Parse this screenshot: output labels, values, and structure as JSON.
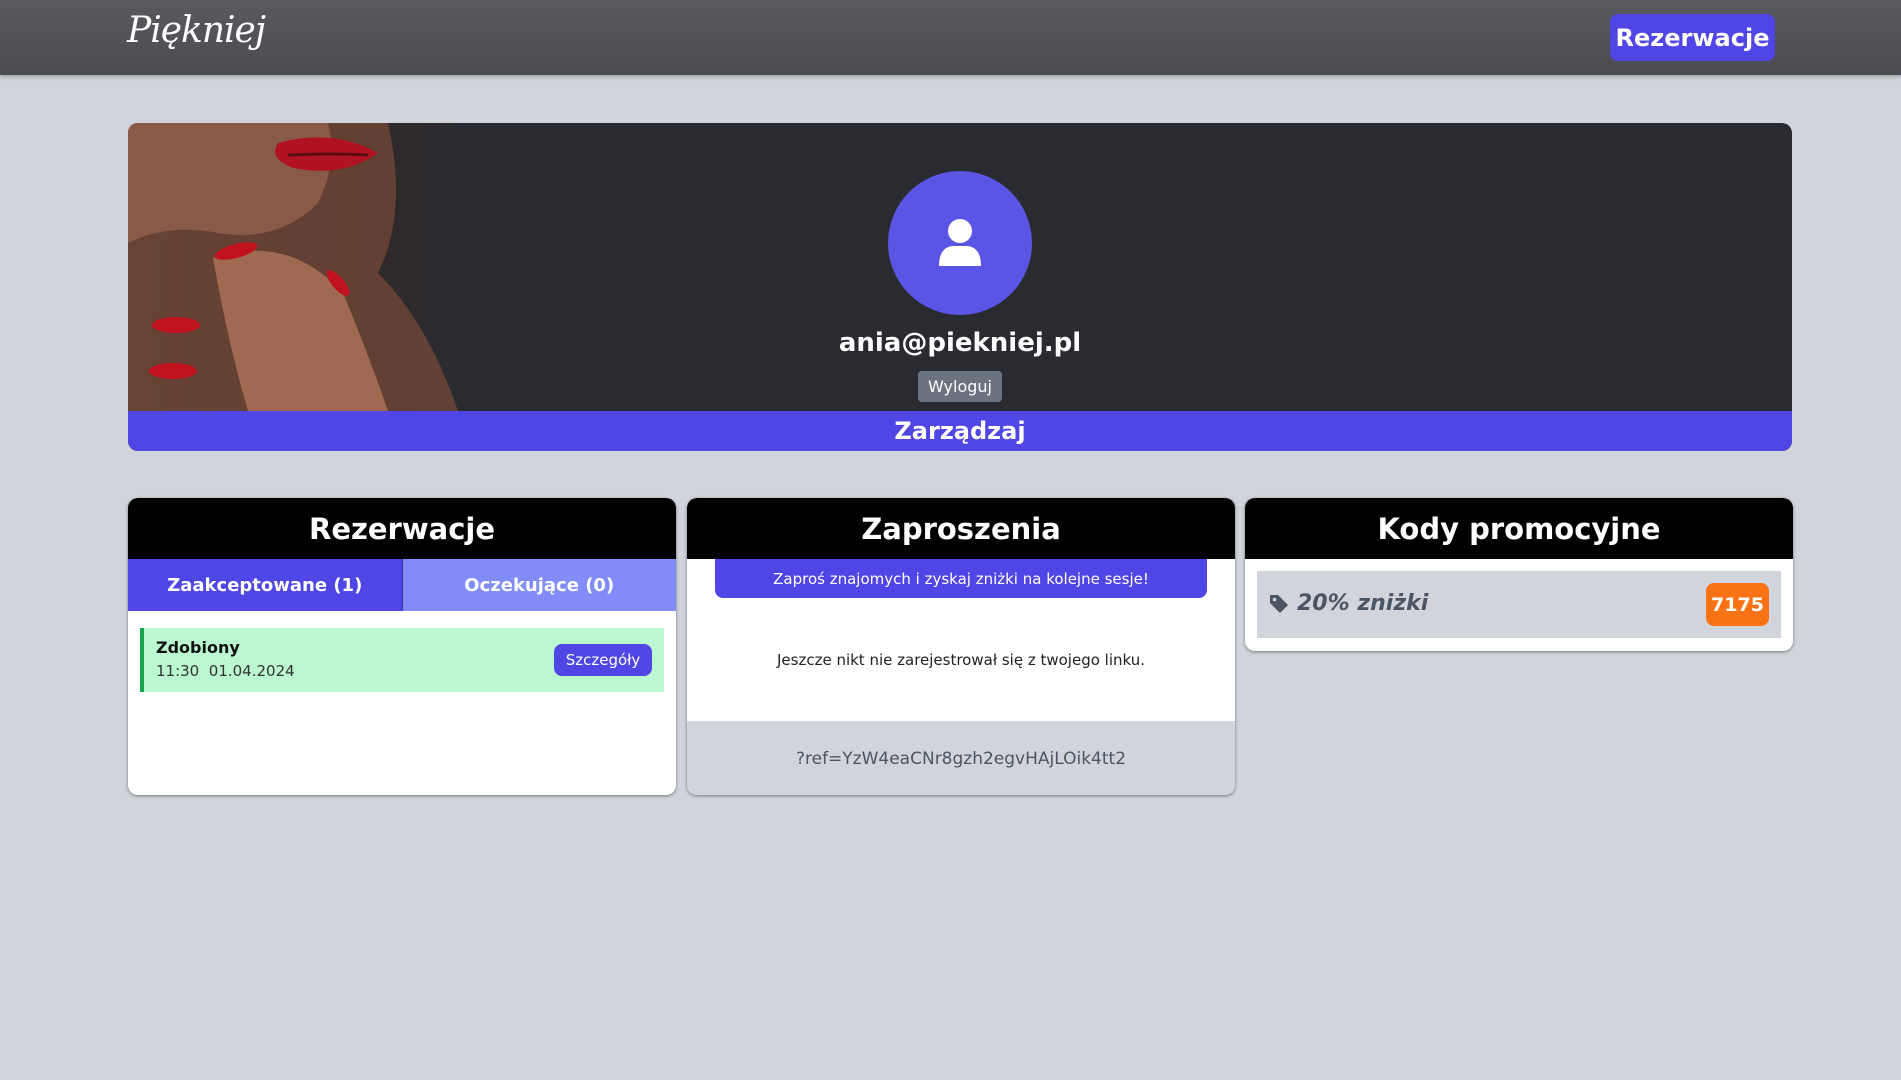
{
  "header": {
    "logo": "Piękniej",
    "nav_button": "Rezerwacje"
  },
  "profile": {
    "email": "ania@piekniej.pl",
    "logout_label": "Wyloguj",
    "manage_label": "Zarządzaj"
  },
  "reservations": {
    "title": "Rezerwacje",
    "tabs": [
      "Zaakceptowane (1)",
      "Oczekujące (0)"
    ],
    "items": [
      {
        "name": "Zdobiony",
        "time": "11:30",
        "date": "01.04.2024",
        "details_label": "Szczegóły",
        "status_color": "#16a34a"
      }
    ]
  },
  "invitations": {
    "title": "Zaproszenia",
    "invite_label": "Zaproś znajomych i zyskaj zniżki na kolejne sesje!",
    "empty_text": "Jeszcze nikt nie zarejestrował się z twojego linku.",
    "ref_link": "?ref=YzW4eaCNr8gzh2egvHAjLOik4tt2"
  },
  "promo": {
    "title": "Kody promocyjne",
    "items": [
      {
        "label": "20% zniżki",
        "code": "7175",
        "icon": "tag-icon"
      }
    ]
  },
  "colors": {
    "accent": "#4f46e5",
    "accent_light": "#818cf8",
    "promo_badge": "#f97316",
    "background": "#d1d5db"
  }
}
